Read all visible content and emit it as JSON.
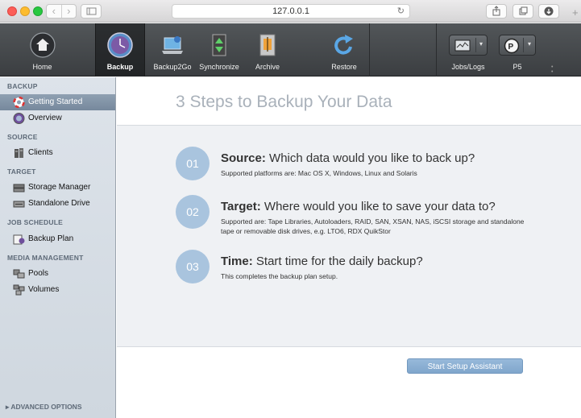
{
  "browser": {
    "url": "127.0.0.1"
  },
  "toolbar": {
    "items": [
      {
        "label": "Home"
      },
      {
        "label": "Backup"
      },
      {
        "label": "Backup2Go"
      },
      {
        "label": "Synchronize"
      },
      {
        "label": "Archive"
      },
      {
        "label": "Restore"
      }
    ],
    "jobs_label": "Jobs/Logs",
    "server_label": "P5"
  },
  "sidebar": {
    "sections": [
      {
        "title": "BACKUP",
        "items": [
          "Getting Started",
          "Overview"
        ]
      },
      {
        "title": "SOURCE",
        "items": [
          "Clients"
        ]
      },
      {
        "title": "TARGET",
        "items": [
          "Storage Manager",
          "Standalone Drive"
        ]
      },
      {
        "title": "JOB SCHEDULE",
        "items": [
          "Backup Plan"
        ]
      },
      {
        "title": "MEDIA MANAGEMENT",
        "items": [
          "Pools",
          "Volumes"
        ]
      }
    ],
    "advanced": "ADVANCED OPTIONS"
  },
  "main": {
    "title": "3 Steps to Backup Your Data",
    "steps": [
      {
        "num": "01",
        "key": "Source:",
        "heading": "Which data would you like to back up?",
        "desc": "Supported platforms are: Mac OS X, Windows, Linux and Solaris"
      },
      {
        "num": "02",
        "key": "Target:",
        "heading": "Where would you like to save your data to?",
        "desc": "Supported are: Tape Libraries, Autoloaders, RAID, SAN, XSAN, NAS, iSCSI storage and standalone tape or removable disk drives, e.g. LTO6, RDX QuikStor"
      },
      {
        "num": "03",
        "key": "Time:",
        "heading": "Start time for the daily backup?",
        "desc": "This completes the backup plan setup."
      }
    ],
    "start_button": "Start Setup Assistant"
  }
}
